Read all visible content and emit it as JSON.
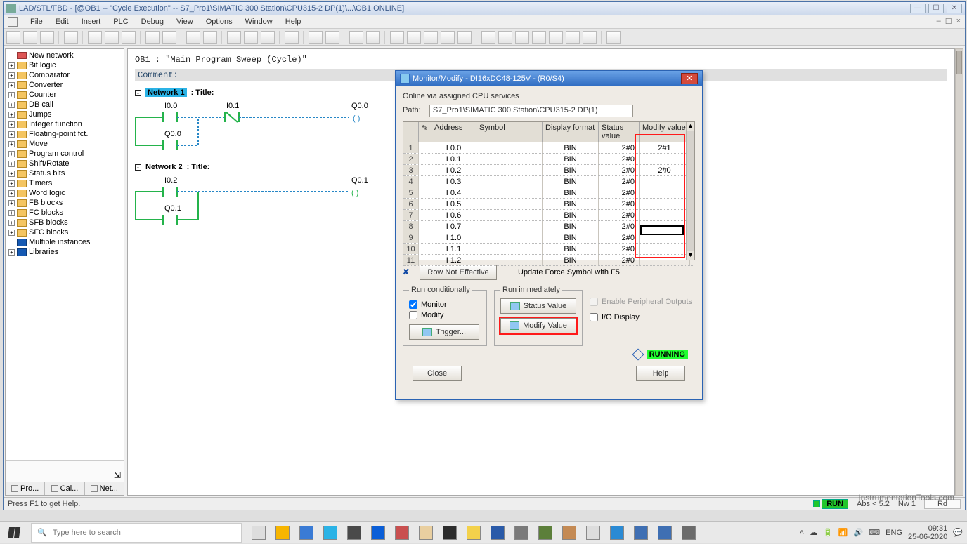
{
  "outer": {
    "title": "LAD/STL/FBD  - [@OB1 -- \"Cycle Execution\" -- S7_Pro1\\SIMATIC 300 Station\\CPU315-2 DP(1)\\...\\OB1  ONLINE]"
  },
  "menu": [
    "File",
    "Edit",
    "Insert",
    "PLC",
    "Debug",
    "View",
    "Options",
    "Window",
    "Help"
  ],
  "tree": {
    "top": "New network",
    "items": [
      "Bit logic",
      "Comparator",
      "Converter",
      "Counter",
      "DB call",
      "Jumps",
      "Integer function",
      "Floating-point fct.",
      "Move",
      "Program control",
      "Shift/Rotate",
      "Status bits",
      "Timers",
      "Word logic",
      "FB blocks",
      "FC blocks",
      "SFB blocks",
      "SFC blocks"
    ],
    "multi": "Multiple instances",
    "libs": "Libraries",
    "tabs": [
      "Pro...",
      "Cal...",
      "Net..."
    ]
  },
  "editor": {
    "ob": "OB1 :   \"Main Program Sweep (Cycle)\"",
    "comment": "Comment:",
    "net1": "Network 1",
    "net2": "Network 2",
    "title_suffix": ": Title:",
    "io": {
      "i00": "I0.0",
      "i01": "I0.1",
      "q00": "Q0.0",
      "q00b": "Q0.0",
      "i02": "I0.2",
      "q01": "Q0.1",
      "q01b": "Q0.1"
    }
  },
  "dialog": {
    "title": "Monitor/Modify - DI16xDC48-125V - (R0/S4)",
    "online": "Online via assigned CPU services",
    "path_label": "Path:",
    "path_value": "S7_Pro1\\SIMATIC 300 Station\\CPU315-2 DP(1)",
    "headers": {
      "addr": "Address",
      "sym": "Symbol",
      "fmt": "Display format",
      "sv": "Status value",
      "mv": "Modify value"
    },
    "rows": [
      {
        "n": "1",
        "a": "I     0.0",
        "f": "BIN",
        "s": "2#0",
        "m": "2#1"
      },
      {
        "n": "2",
        "a": "I     0.1",
        "f": "BIN",
        "s": "2#0",
        "m": ""
      },
      {
        "n": "3",
        "a": "I     0.2",
        "f": "BIN",
        "s": "2#0",
        "m": "2#0"
      },
      {
        "n": "4",
        "a": "I     0.3",
        "f": "BIN",
        "s": "2#0",
        "m": ""
      },
      {
        "n": "5",
        "a": "I     0.4",
        "f": "BIN",
        "s": "2#0",
        "m": ""
      },
      {
        "n": "6",
        "a": "I     0.5",
        "f": "BIN",
        "s": "2#0",
        "m": ""
      },
      {
        "n": "7",
        "a": "I     0.6",
        "f": "BIN",
        "s": "2#0",
        "m": ""
      },
      {
        "n": "8",
        "a": "I     0.7",
        "f": "BIN",
        "s": "2#0",
        "m": ""
      },
      {
        "n": "9",
        "a": "I     1.0",
        "f": "BIN",
        "s": "2#0",
        "m": ""
      },
      {
        "n": "10",
        "a": "I     1.1",
        "f": "BIN",
        "s": "2#0",
        "m": ""
      },
      {
        "n": "11",
        "a": "I     1.2",
        "f": "BIN",
        "s": "2#0",
        "m": ""
      }
    ],
    "row_not_eff": "Row Not Effective",
    "update_force": "Update Force Symbol with F5",
    "fs_cond": "Run conditionally",
    "fs_imm": "Run immediately",
    "monitor": "Monitor",
    "modify": "Modify",
    "trigger": "Trigger...",
    "status_value": "Status Value",
    "modify_value": "Modify Value",
    "enable_po": "Enable Peripheral Outputs",
    "io_display": "I/O Display",
    "running": "RUNNING",
    "close": "Close",
    "help": "Help"
  },
  "status": {
    "hint": "Press F1 to get Help.",
    "run": "RUN",
    "abs": "Abs < 5.2",
    "nw": "Nw 1",
    "rd": "Rd"
  },
  "watermark": "InstrumentationTools.com",
  "taskbar": {
    "search_placeholder": "Type here to search",
    "lang": "ENG",
    "time": "09:31",
    "date": "25-06-2020"
  }
}
